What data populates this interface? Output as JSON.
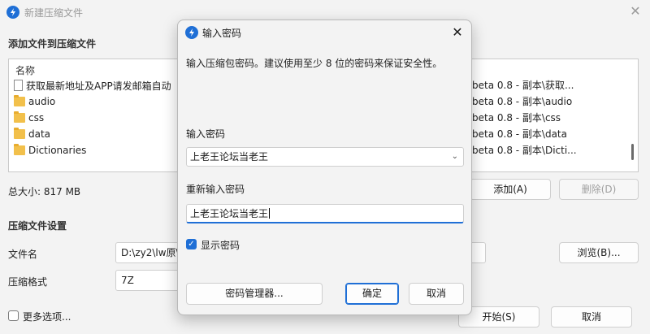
{
  "main": {
    "title": "新建压缩文件",
    "close_glyph": "✕",
    "section_add": "添加文件到压缩文件",
    "list": {
      "column_name": "名称",
      "items": [
        {
          "name": "获取最新地址及APP请发邮箱自动",
          "icon": "document-icon",
          "path": "beta 0.8 - 副本\\获取..."
        },
        {
          "name": "audio",
          "icon": "folder-icon",
          "path": "beta 0.8 - 副本\\audio"
        },
        {
          "name": "css",
          "icon": "folder-icon",
          "path": "beta 0.8 - 副本\\css"
        },
        {
          "name": "data",
          "icon": "folder-icon",
          "path": "beta 0.8 - 副本\\data"
        },
        {
          "name": "Dictionaries",
          "icon": "folder-icon",
          "path": "beta 0.8 - 副本\\Dicti..."
        }
      ]
    },
    "total_size": "总大小: 817 MB",
    "add_button": "添加(A)",
    "remove_button": "删除(D)",
    "section_settings": "压缩文件设置",
    "filename_label": "文件名",
    "filename_value": "D:\\zy2\\lw原\\",
    "browse_button": "浏览(B)...",
    "format_label": "压缩格式",
    "format_value": "7Z",
    "more_options": "更多选项...",
    "start_button": "开始(S)",
    "cancel_button": "取消"
  },
  "dialog": {
    "title": "输入密码",
    "close_glyph": "✕",
    "description": "输入压缩包密码。建议使用至少 8 位的密码来保证安全性。",
    "password_label": "输入密码",
    "password_value": "上老王论坛当老王",
    "confirm_label": "重新输入密码",
    "confirm_value": "上老王论坛当老王",
    "show_password_label": "显示密码",
    "show_password_checked": true,
    "manager_button": "密码管理器...",
    "ok_button": "确定",
    "cancel_button": "取消"
  },
  "colors": {
    "accent": "#1f6fd6",
    "window_bg": "#f3f3f3"
  }
}
